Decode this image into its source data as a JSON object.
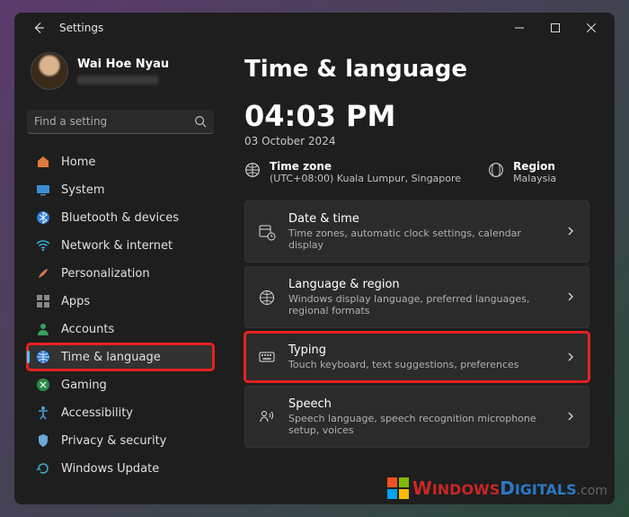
{
  "titlebar": {
    "title": "Settings"
  },
  "profile": {
    "name": "Wai Hoe Nyau"
  },
  "search": {
    "placeholder": "Find a setting"
  },
  "sidebar": {
    "items": [
      {
        "label": "Home"
      },
      {
        "label": "System"
      },
      {
        "label": "Bluetooth & devices"
      },
      {
        "label": "Network & internet"
      },
      {
        "label": "Personalization"
      },
      {
        "label": "Apps"
      },
      {
        "label": "Accounts"
      },
      {
        "label": "Time & language"
      },
      {
        "label": "Gaming"
      },
      {
        "label": "Accessibility"
      },
      {
        "label": "Privacy & security"
      },
      {
        "label": "Windows Update"
      }
    ]
  },
  "page": {
    "title": "Time & language",
    "clock": "04:03 PM",
    "date": "03 October 2024",
    "timezone": {
      "label": "Time zone",
      "value": "(UTC+08:00) Kuala Lumpur, Singapore"
    },
    "region": {
      "label": "Region",
      "value": "Malaysia"
    },
    "cards": [
      {
        "title": "Date & time",
        "sub": "Time zones, automatic clock settings, calendar display"
      },
      {
        "title": "Language & region",
        "sub": "Windows display language, preferred languages, regional formats"
      },
      {
        "title": "Typing",
        "sub": "Touch keyboard, text suggestions, preferences"
      },
      {
        "title": "Speech",
        "sub": "Speech language, speech recognition microphone setup, voices"
      }
    ]
  },
  "watermark": {
    "part1": "W",
    "part2": "INDOWS",
    "part3": "D",
    "part4": "IGITALS",
    "suffix": ".com"
  }
}
